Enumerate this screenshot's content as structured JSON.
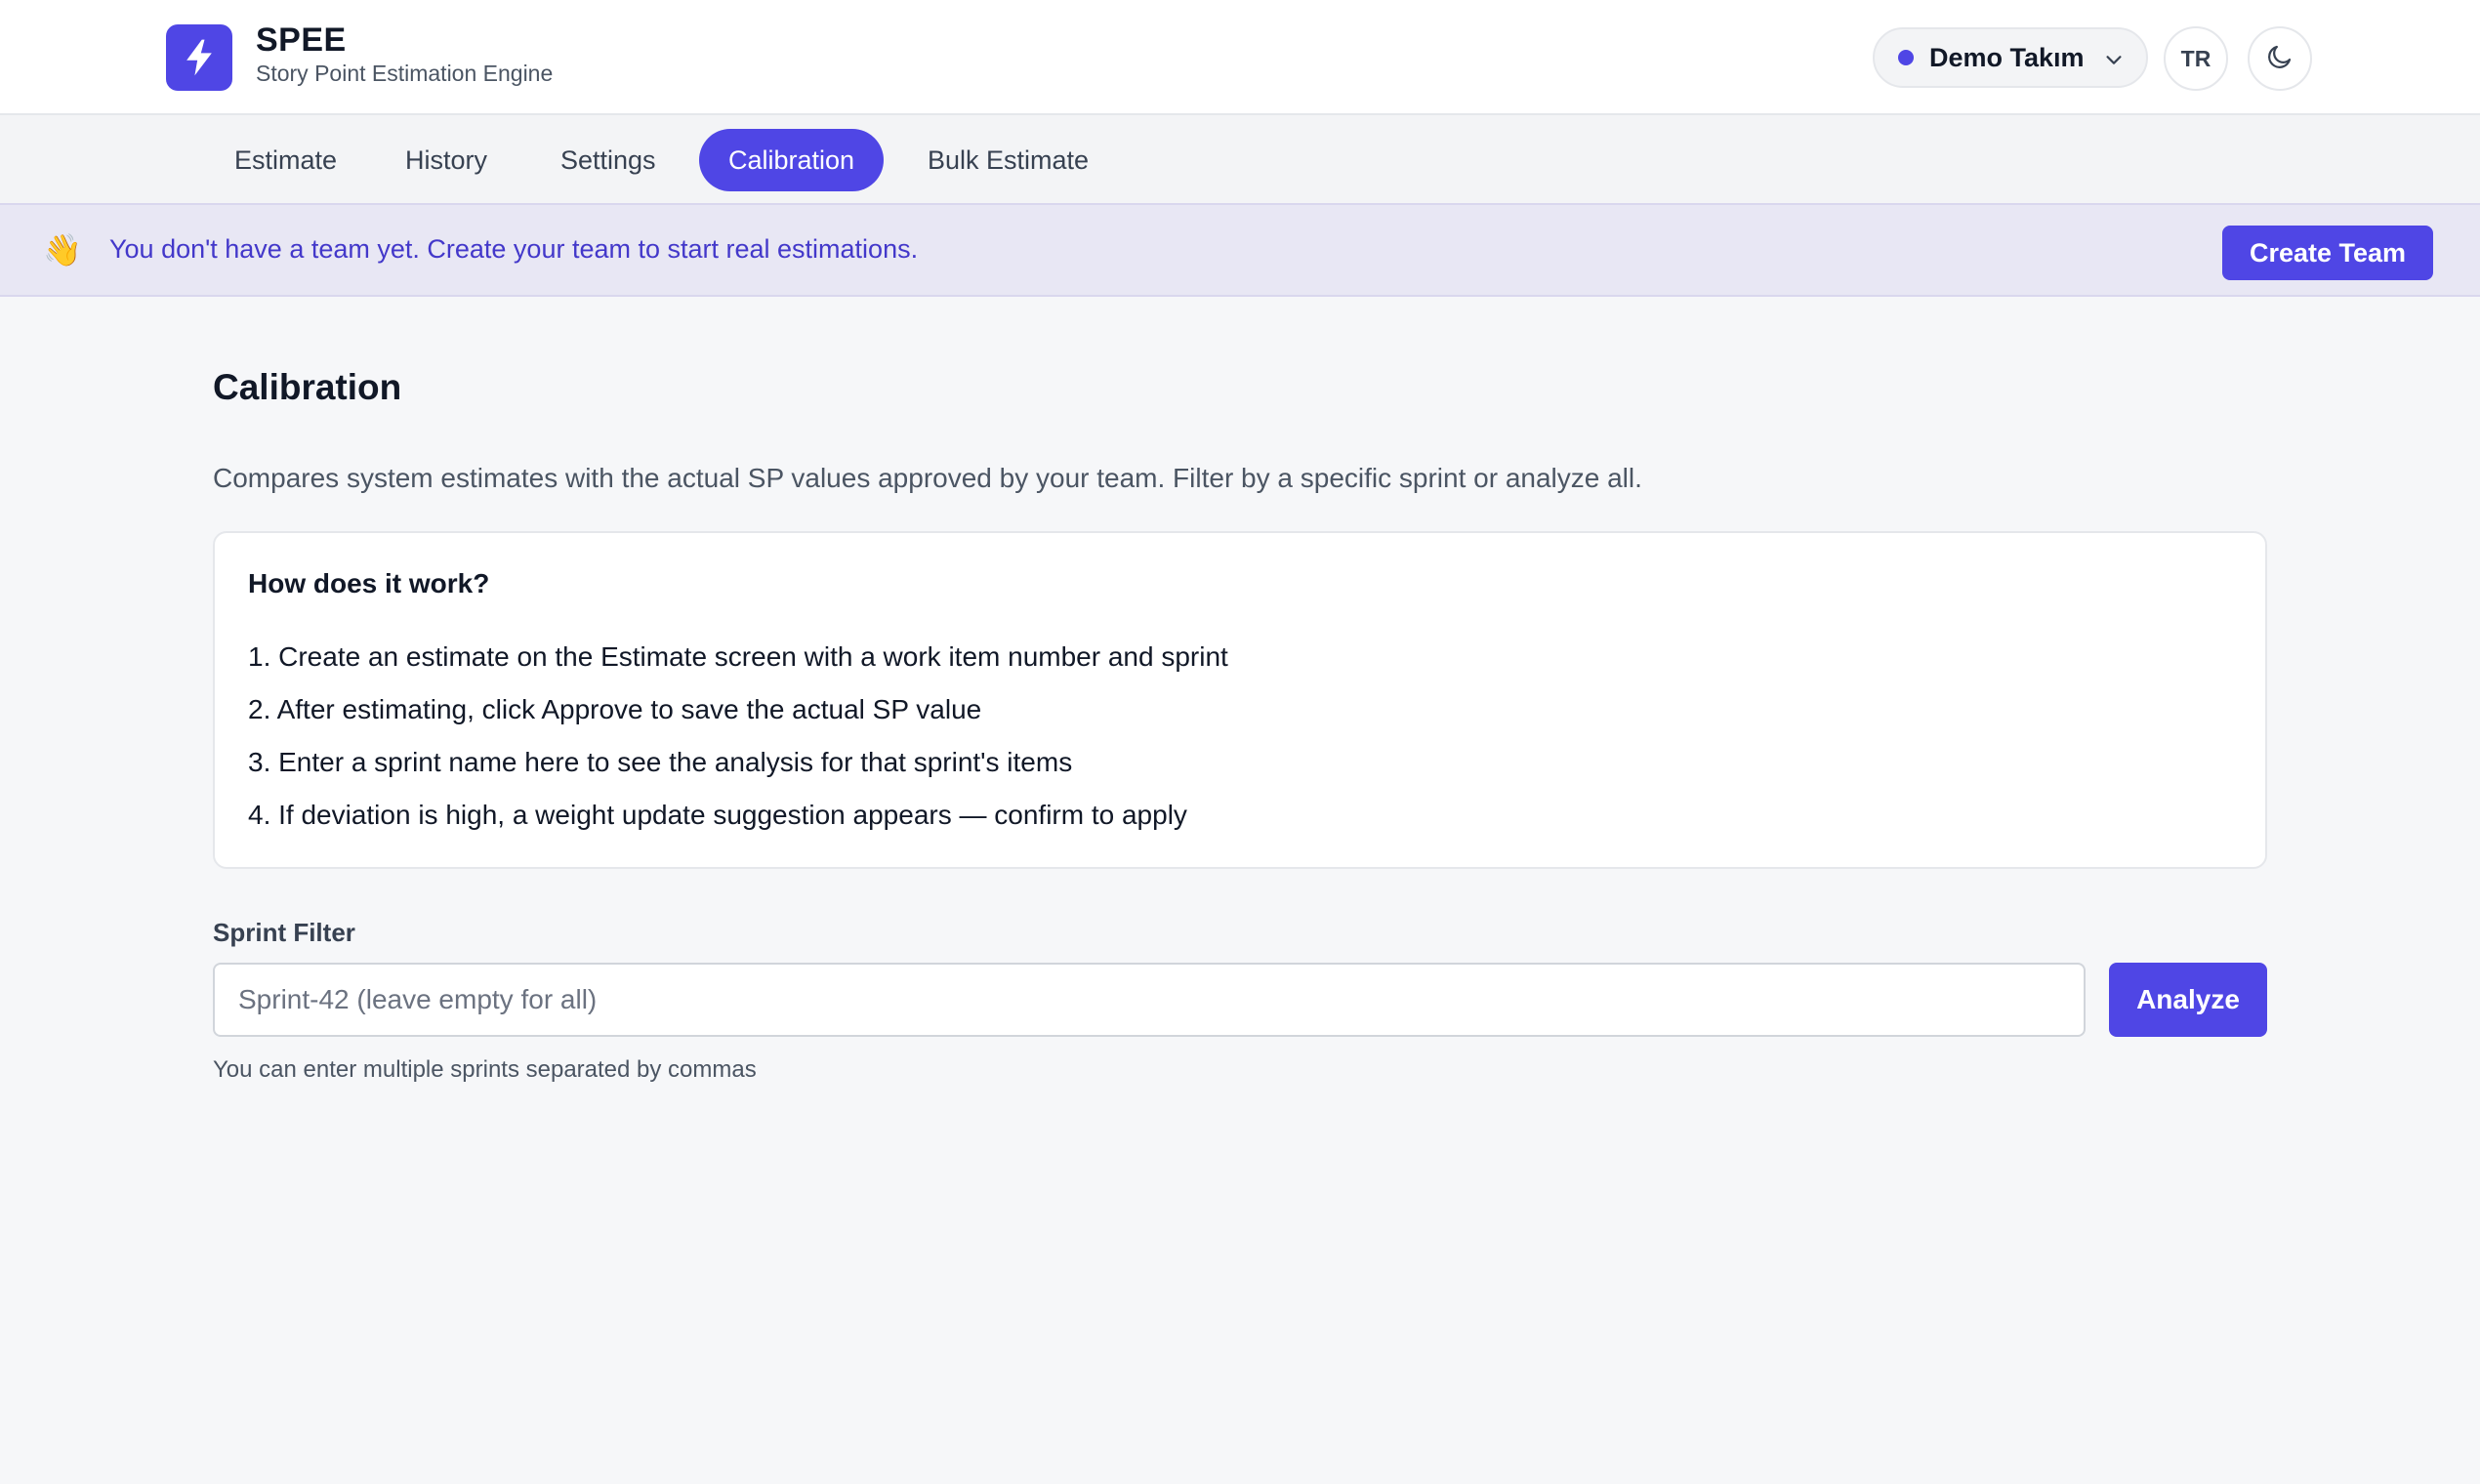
{
  "app": {
    "name": "SPEE",
    "subtitle": "Story Point Estimation Engine",
    "logo_icon": "lightning-bolt-icon",
    "accent_color": "#4f46e5"
  },
  "header": {
    "team_selector": {
      "label": "Demo Takım",
      "status_color": "#4f46e5"
    },
    "language_button": "TR",
    "theme_toggle_icon": "moon-icon"
  },
  "nav": {
    "tabs": [
      {
        "label": "Estimate",
        "active": false
      },
      {
        "label": "History",
        "active": false
      },
      {
        "label": "Settings",
        "active": false
      },
      {
        "label": "Calibration",
        "active": true
      },
      {
        "label": "Bulk Estimate",
        "active": false
      }
    ]
  },
  "banner": {
    "icon": "👋",
    "text": "You don't have a team yet. Create your team to start real estimations.",
    "button_label": "Create Team"
  },
  "main": {
    "title": "Calibration",
    "description": "Compares system estimates with the actual SP values approved by your team. Filter by a specific sprint or analyze all.",
    "info": {
      "title": "How does it work?",
      "steps": [
        "1. Create an estimate on the Estimate screen with a work item number and sprint",
        "2. After estimating, click Approve to save the actual SP value",
        "3. Enter a sprint name here to see the analysis for that sprint's items",
        "4. If deviation is high, a weight update suggestion appears — confirm to apply"
      ]
    },
    "filter": {
      "label": "Sprint Filter",
      "placeholder": "Sprint-42 (leave empty for all)",
      "value": "",
      "button_label": "Analyze",
      "hint": "You can enter multiple sprints separated by commas"
    }
  }
}
